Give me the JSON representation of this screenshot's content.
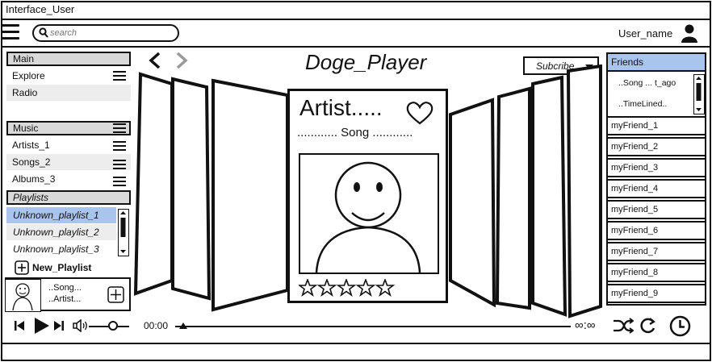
{
  "window": {
    "title": "Interface_User"
  },
  "header": {
    "search_placeholder": "search",
    "username": "User_name"
  },
  "sidebar": {
    "main_header": "Main",
    "main_items": [
      {
        "label": "Explore"
      },
      {
        "label": "Radio"
      }
    ],
    "music_header": "Music",
    "music_items": [
      {
        "label": "Artists_1"
      },
      {
        "label": "Songs_2"
      },
      {
        "label": "Albums_3"
      }
    ],
    "playlists_header": "Playlists",
    "playlists": [
      {
        "label": "Unknown_playlist_1",
        "selected": true
      },
      {
        "label": "Unknown_playlist_2"
      },
      {
        "label": "Unknown_playlist_3"
      }
    ],
    "new_playlist_label": "New_Playlist"
  },
  "now_playing": {
    "song": "..Song...",
    "artist": "..Artist..."
  },
  "center": {
    "app_title": "Doge_Player",
    "subscribe_label": "Subcribe",
    "card_artist": "Artist.....",
    "card_song": "............  Song  ............",
    "rating": {
      "value": 0,
      "max": 5
    }
  },
  "friends": {
    "header": "Friends",
    "activity": [
      "..Song ... t_ago",
      "..TimeLined.."
    ],
    "list": [
      "myFriend_1",
      "myFriend_2",
      "myFriend_3",
      "myFriend_4",
      "myFriend_5",
      "myFriend_6",
      "myFriend_7",
      "myFriend_8",
      "myFriend_9"
    ]
  },
  "player": {
    "elapsed": "00:00",
    "total": "∞:∞",
    "progress": 0.02,
    "volume": 0.6
  }
}
